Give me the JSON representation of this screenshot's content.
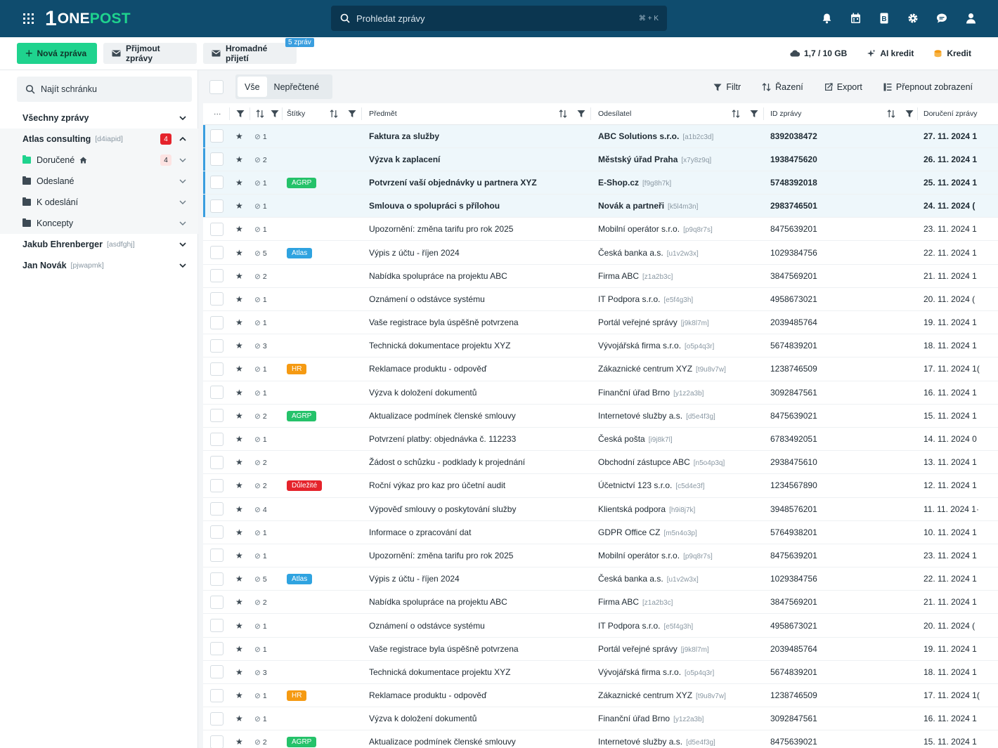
{
  "brand": {
    "logo_mark": "1",
    "logo_text_one": "ONE",
    "logo_text_post": "POST"
  },
  "search": {
    "placeholder": "Prohledat zprávy",
    "shortcut": "⌘ + K"
  },
  "top_icons": [
    "bell-icon",
    "calendar-icon",
    "address-book-icon",
    "gear-icon",
    "chat-icon",
    "user-icon"
  ],
  "actions": {
    "new_message": "Nová zpráva",
    "receive": "Přijmout zprávy",
    "bulk_receive": "Hromadné přijetí",
    "bulk_badge": "5 zpráv",
    "storage": "1,7 / 10 GB",
    "ai_credit": "AI kredit",
    "credit": "Kredit"
  },
  "sidebar": {
    "search_placeholder": "Najít schránku",
    "all_messages": "Všechny zprávy",
    "accounts": [
      {
        "name": "Atlas consulting",
        "tag": "[d4iapid]",
        "count": "4"
      },
      {
        "name": "Jakub Ehrenberger",
        "tag": "[asdfghj]"
      },
      {
        "name": "Jan Novák",
        "tag": "[pjwapmk]"
      }
    ],
    "folders": [
      {
        "name": "Doručené",
        "count": "4"
      },
      {
        "name": "Odeslané"
      },
      {
        "name": "K odeslání"
      },
      {
        "name": "Koncepty"
      }
    ]
  },
  "filter_tabs": {
    "all": "Vše",
    "unread": "Nepřečtené"
  },
  "tools": {
    "filter": "Filtr",
    "sort": "Řazení",
    "export": "Export",
    "switch_view": "Přepnout zobrazení"
  },
  "columns": {
    "more": "···",
    "tags": "Štítky",
    "subject": "Předmět",
    "sender": "Odesílatel",
    "id": "ID zprávy",
    "delivered": "Doručení zprávy"
  },
  "tag_colors": {
    "AGRP": "#25c26a",
    "Atlas": "#2fa3e0",
    "HR": "#f59a12",
    "Důležité": "#e5232b"
  },
  "messages": [
    {
      "att": "1",
      "tag": "",
      "subject": "Faktura za služby",
      "sender": "ABC Solutions s.r.o.",
      "sender_tag": "[a1b2c3d]",
      "id": "8392038472",
      "date": "27. 11. 2024 1",
      "unread": true
    },
    {
      "att": "2",
      "tag": "",
      "subject": "Výzva k zaplacení",
      "sender": "Městský úřad Praha",
      "sender_tag": "[x7y8z9q]",
      "id": "1938475620",
      "date": "26. 11. 2024 1",
      "unread": true
    },
    {
      "att": "1",
      "tag": "AGRP",
      "subject": "Potvrzení vaší objednávky u partnera XYZ",
      "sender": "E-Shop.cz",
      "sender_tag": "[f9g8h7k]",
      "id": "5748392018",
      "date": "25. 11. 2024 1",
      "unread": true
    },
    {
      "att": "1",
      "tag": "",
      "subject": "Smlouva o spolupráci s přílohou",
      "sender": "Novák a partneři",
      "sender_tag": "[k5l4m3n]",
      "id": "2983746501",
      "date": "24. 11. 2024 (",
      "unread": true
    },
    {
      "att": "1",
      "tag": "",
      "subject": "Upozornění: změna tarifu pro rok 2025",
      "sender": "Mobilní operátor s.r.o.",
      "sender_tag": "[p9q8r7s]",
      "id": "8475639201",
      "date": "23. 11. 2024 1",
      "unread": false
    },
    {
      "att": "5",
      "tag": "Atlas",
      "subject": "Výpis z účtu - říjen 2024",
      "sender": "Česká banka a.s.",
      "sender_tag": "[u1v2w3x]",
      "id": "1029384756",
      "date": "22. 11. 2024 1",
      "unread": false
    },
    {
      "att": "2",
      "tag": "",
      "subject": "Nabídka spolupráce na projektu ABC",
      "sender": "Firma ABC",
      "sender_tag": "[z1a2b3c]",
      "id": "3847569201",
      "date": "21. 11. 2024 1",
      "unread": false
    },
    {
      "att": "1",
      "tag": "",
      "subject": "Oznámení o odstávce systému",
      "sender": "IT Podpora s.r.o.",
      "sender_tag": "[e5f4g3h]",
      "id": "4958673021",
      "date": "20. 11. 2024 (",
      "unread": false
    },
    {
      "att": "1",
      "tag": "",
      "subject": "Vaše registrace byla úspěšně potvrzena",
      "sender": "Portál veřejné správy",
      "sender_tag": "[j9k8l7m]",
      "id": "2039485764",
      "date": "19. 11. 2024 1",
      "unread": false
    },
    {
      "att": "3",
      "tag": "",
      "subject": "Technická dokumentace projektu XYZ",
      "sender": "Vývojářská firma s.r.o.",
      "sender_tag": "[o5p4q3r]",
      "id": "5674839201",
      "date": "18. 11. 2024 1",
      "unread": false
    },
    {
      "att": "1",
      "tag": "HR",
      "subject": "Reklamace produktu - odpověď",
      "sender": "Zákaznické centrum XYZ",
      "sender_tag": "[t9u8v7w]",
      "id": "1238746509",
      "date": "17. 11. 2024 1(",
      "unread": false
    },
    {
      "att": "1",
      "tag": "",
      "subject": "Výzva k doložení dokumentů",
      "sender": "Finanční úřad Brno",
      "sender_tag": "[y1z2a3b]",
      "id": "3092847561",
      "date": "16. 11. 2024 1",
      "unread": false
    },
    {
      "att": "2",
      "tag": "AGRP",
      "subject": "Aktualizace podmínek členské smlouvy",
      "sender": "Internetové služby a.s.",
      "sender_tag": "[d5e4f3g]",
      "id": "8475639021",
      "date": "15. 11. 2024 1",
      "unread": false
    },
    {
      "att": "1",
      "tag": "",
      "subject": "Potvrzení platby: objednávka č. 112233",
      "sender": "Česká pošta",
      "sender_tag": "[i9j8k7l]",
      "id": "6783492051",
      "date": "14. 11. 2024 0",
      "unread": false
    },
    {
      "att": "2",
      "tag": "",
      "subject": "Žádost o schůzku - podklady k projednání",
      "sender": "Obchodní zástupce ABC",
      "sender_tag": "[n5o4p3q]",
      "id": "2938475610",
      "date": "13. 11. 2024 1",
      "unread": false
    },
    {
      "att": "2",
      "tag": "Důležité",
      "subject": "Roční výkaz pro kaz pro účetní audit",
      "sender": "Účetnictví 123 s.r.o.",
      "sender_tag": "[c5d4e3f]",
      "id": "1234567890",
      "date": "12. 11. 2024 1",
      "unread": false
    },
    {
      "att": "4",
      "tag": "",
      "subject": "Výpověď smlouvy o poskytování služby",
      "sender": "Klientská podpora",
      "sender_tag": "[h9i8j7k]",
      "id": "3948576201",
      "date": "11. 11. 2024 1·",
      "unread": false
    },
    {
      "att": "1",
      "tag": "",
      "subject": "Informace o zpracování dat",
      "sender": "GDPR Office CZ",
      "sender_tag": "[m5n4o3p]",
      "id": "5764938201",
      "date": "10. 11. 2024 1",
      "unread": false
    },
    {
      "att": "1",
      "tag": "",
      "subject": "Upozornění: změna tarifu pro rok 2025",
      "sender": "Mobilní operátor s.r.o.",
      "sender_tag": "[p9q8r7s]",
      "id": "8475639201",
      "date": "23. 11. 2024 1",
      "unread": false
    },
    {
      "att": "5",
      "tag": "Atlas",
      "subject": "Výpis z účtu - říjen 2024",
      "sender": "Česká banka a.s.",
      "sender_tag": "[u1v2w3x]",
      "id": "1029384756",
      "date": "22. 11. 2024 1",
      "unread": false
    },
    {
      "att": "2",
      "tag": "",
      "subject": "Nabídka spolupráce na projektu ABC",
      "sender": "Firma ABC",
      "sender_tag": "[z1a2b3c]",
      "id": "3847569201",
      "date": "21. 11. 2024 1",
      "unread": false
    },
    {
      "att": "1",
      "tag": "",
      "subject": "Oznámení o odstávce systému",
      "sender": "IT Podpora s.r.o.",
      "sender_tag": "[e5f4g3h]",
      "id": "4958673021",
      "date": "20. 11. 2024 (",
      "unread": false
    },
    {
      "att": "1",
      "tag": "",
      "subject": "Vaše registrace byla úspěšně potvrzena",
      "sender": "Portál veřejné správy",
      "sender_tag": "[j9k8l7m]",
      "id": "2039485764",
      "date": "19. 11. 2024 1",
      "unread": false
    },
    {
      "att": "3",
      "tag": "",
      "subject": "Technická dokumentace projektu XYZ",
      "sender": "Vývojářská firma s.r.o.",
      "sender_tag": "[o5p4q3r]",
      "id": "5674839201",
      "date": "18. 11. 2024 1",
      "unread": false
    },
    {
      "att": "1",
      "tag": "HR",
      "subject": "Reklamace produktu - odpověď",
      "sender": "Zákaznické centrum XYZ",
      "sender_tag": "[t9u8v7w]",
      "id": "1238746509",
      "date": "17. 11. 2024 1(",
      "unread": false
    },
    {
      "att": "1",
      "tag": "",
      "subject": "Výzva k doložení dokumentů",
      "sender": "Finanční úřad Brno",
      "sender_tag": "[y1z2a3b]",
      "id": "3092847561",
      "date": "16. 11. 2024 1",
      "unread": false
    },
    {
      "att": "2",
      "tag": "AGRP",
      "subject": "Aktualizace podmínek členské smlouvy",
      "sender": "Internetové služby a.s.",
      "sender_tag": "[d5e4f3g]",
      "id": "8475639021",
      "date": "15. 11. 2024 1",
      "unread": false
    }
  ]
}
